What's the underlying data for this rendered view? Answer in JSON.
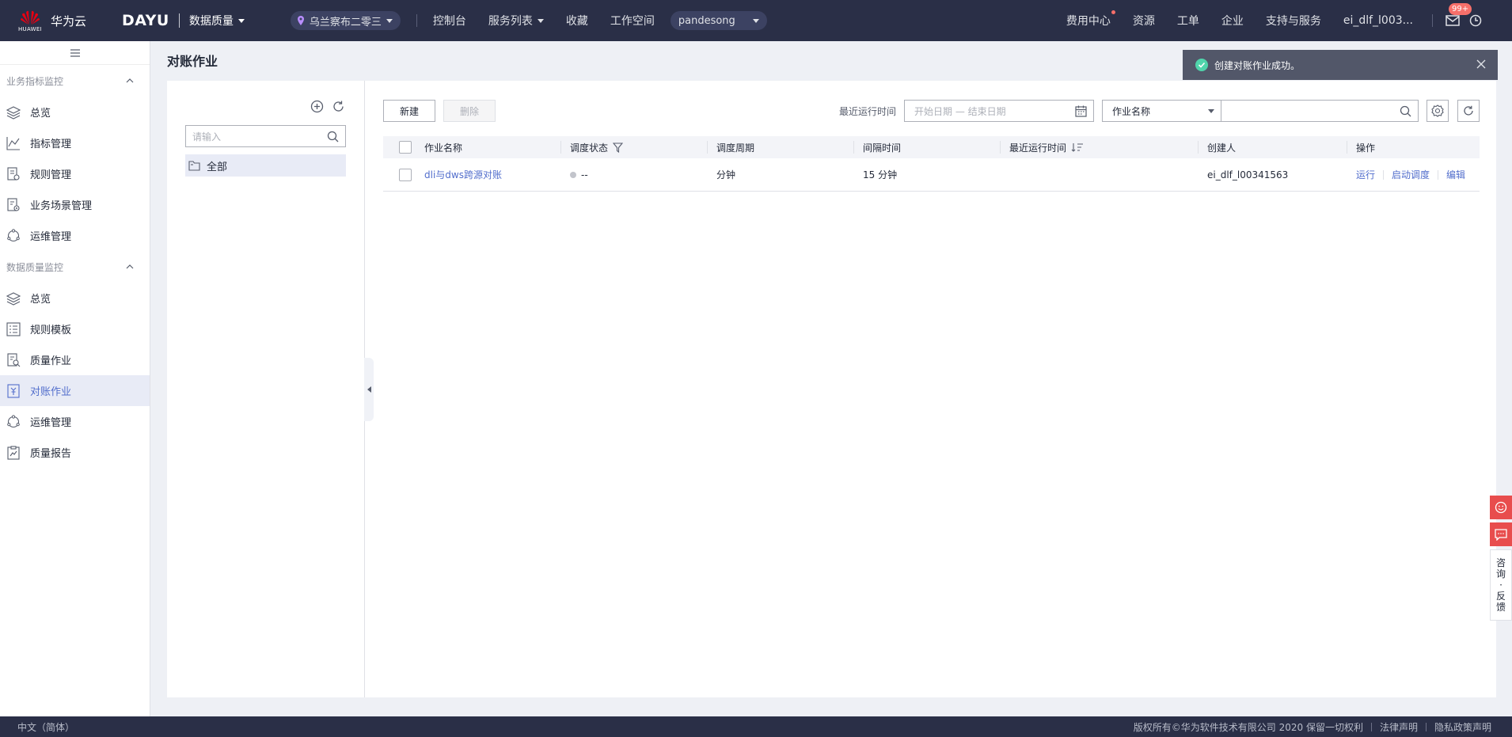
{
  "header": {
    "brand": "华为云",
    "brand_sub": "HUAWEI",
    "product": "DAYU",
    "service": "数据质量",
    "region": "乌兰察布二零三",
    "nav": [
      "控制台",
      "服务列表",
      "收藏",
      "工作空间"
    ],
    "project": "pandesong",
    "right_nav": [
      "费用中心",
      "资源",
      "工单",
      "企业",
      "支持与服务"
    ],
    "user": "ei_dlf_l003...",
    "mail_badge": "99+"
  },
  "sidebar": {
    "section1": "业务指标监控",
    "section1_items": [
      {
        "label": "总览",
        "icon": "layers-icon"
      },
      {
        "label": "指标管理",
        "icon": "line-chart-icon"
      },
      {
        "label": "规则管理",
        "icon": "rule-doc-icon"
      },
      {
        "label": "业务场景管理",
        "icon": "scene-doc-icon"
      },
      {
        "label": "运维管理",
        "icon": "ops-cycle-icon"
      }
    ],
    "section2": "数据质量监控",
    "section2_items": [
      {
        "label": "总览",
        "icon": "layers-icon"
      },
      {
        "label": "规则模板",
        "icon": "template-icon"
      },
      {
        "label": "质量作业",
        "icon": "quality-job-icon"
      },
      {
        "label": "对账作业",
        "icon": "reconcile-icon",
        "active": true
      },
      {
        "label": "运维管理",
        "icon": "ops-cycle-icon"
      },
      {
        "label": "质量报告",
        "icon": "report-icon"
      }
    ]
  },
  "page": {
    "title": "对账作业",
    "tree_search_placeholder": "请输入",
    "tree_root": "全部",
    "btn_new": "新建",
    "btn_delete": "删除",
    "last_run_label": "最近运行时间",
    "date_placeholder": "开始日期 — 结束日期",
    "search_field": "作业名称",
    "search_value": ""
  },
  "table": {
    "headers": [
      "作业名称",
      "调度状态",
      "调度周期",
      "间隔时间",
      "最近运行时间",
      "创建人",
      "操作"
    ],
    "rows": [
      {
        "name": "dli与dws跨源对账",
        "status": "--",
        "cycle": "分钟",
        "interval": "15 分钟",
        "last_run": "",
        "creator": "ei_dlf_l00341563",
        "ops": [
          "运行",
          "启动调度",
          "编辑"
        ]
      }
    ]
  },
  "toast": {
    "message": "创建对账作业成功。"
  },
  "float_widget": {
    "chars": [
      "咨",
      "询",
      "·",
      "反",
      "馈"
    ]
  },
  "footer": {
    "lang": "中文（简体）",
    "copyright": "版权所有©华为软件技术有限公司 2020 保留一切权利",
    "legal": "法律声明",
    "privacy": "隐私政策声明"
  },
  "colors": {
    "topbar": "#2a2f47",
    "accent": "#526ecc",
    "danger": "#e84d4d",
    "success": "#50d4ab"
  }
}
